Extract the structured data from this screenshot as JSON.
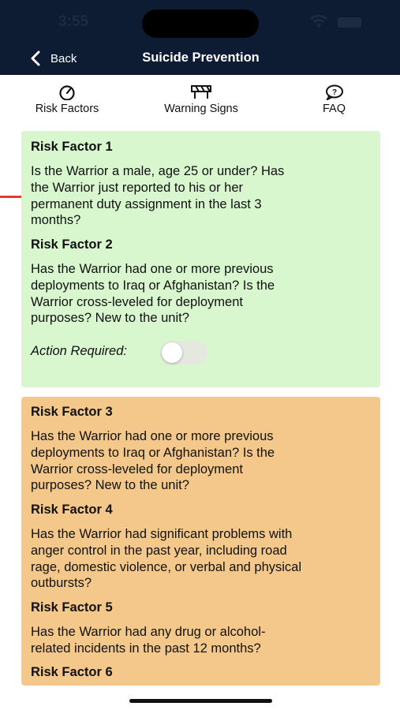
{
  "status": {
    "time": "3:55"
  },
  "nav": {
    "back_label": "Back",
    "title": "Suicide Prevention"
  },
  "tabs": [
    {
      "label": "Risk Factors",
      "icon": "gauge-icon",
      "active": true
    },
    {
      "label": "Warning Signs",
      "icon": "barrier-icon",
      "active": false
    },
    {
      "label": "FAQ",
      "icon": "question-bubble-icon",
      "active": false
    }
  ],
  "colors": {
    "header": "#0d1b33",
    "tab_active": "#e03a3a",
    "green_card": "#d9f7cf",
    "orange_card": "#f4c88a"
  },
  "green_card": {
    "items": [
      {
        "title": "Risk Factor 1",
        "text": [
          "Is the Warrior a male, age 25 or under? Has",
          "the Warrior just reported to his or her",
          "permanent duty assignment in the last 3",
          "months?"
        ]
      },
      {
        "title": "Risk Factor 2",
        "text": [
          "Has the Warrior had one or more previous",
          "deployments to Iraq or Afghanistan? Is the",
          "Warrior cross-leveled for deployment",
          "purposes? New to the unit?"
        ]
      }
    ],
    "action_label": "Action Required:",
    "action_on": false
  },
  "orange_card": {
    "items": [
      {
        "title": "Risk Factor 3",
        "text": [
          "Has the Warrior had one or more previous",
          "deployments to Iraq or Afghanistan? Is the",
          "Warrior cross-leveled for deployment",
          "purposes? New to the unit?"
        ]
      },
      {
        "title": "Risk Factor 4",
        "text": [
          "Has the Warrior had significant problems with",
          "anger control in the past year, including road",
          "rage, domestic violence, or verbal and physical",
          "outbursts?"
        ]
      },
      {
        "title": "Risk Factor 5",
        "text": [
          "Has the Warrior had any drug or alcohol-",
          "related incidents in the past 12 months?"
        ]
      },
      {
        "title": "Risk Factor 6",
        "text": []
      }
    ]
  }
}
